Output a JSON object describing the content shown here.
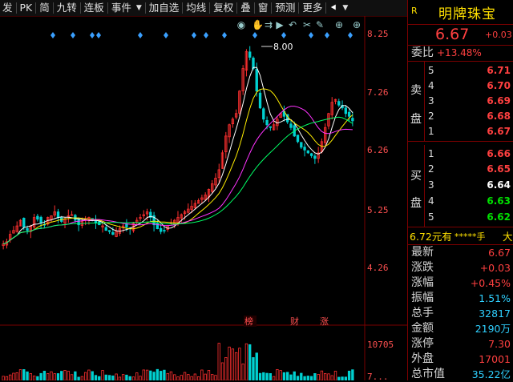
{
  "toolbar": {
    "items": [
      "发",
      "PK",
      "简",
      "九转",
      "连板",
      "事件",
      "▼",
      "加自选",
      "均线",
      "复权",
      "叠",
      "窗",
      "预测",
      "更多",
      "⯇",
      "▼"
    ]
  },
  "chart_icons": [
    "eye-icon",
    "hand-icon",
    "forward-icon",
    "play-icon",
    "undo-icon",
    "scissors-icon",
    "edit-icon",
    "plus-icon",
    "plus-icon"
  ],
  "price_axis": {
    "labels": [
      "8.25",
      "7.26",
      "6.26",
      "5.25",
      "4.26"
    ]
  },
  "volume_axis": {
    "labels": [
      "10705",
      "7..."
    ]
  },
  "annotations": {
    "high_label": "8.00",
    "events": [
      "榜",
      "财",
      "涨"
    ]
  },
  "colors": {
    "up": "#ff3030",
    "down": "#00d0d0",
    "ma5": "#ffffff",
    "ma10": "#ffee00",
    "ma20": "#ff33ff",
    "ma60": "#00ff66",
    "diamond": "#3aa0ff"
  },
  "chart_data": {
    "type": "candlestick",
    "ylim": [
      4.26,
      8.25
    ],
    "y_ticks": [
      8.25,
      7.26,
      6.26,
      5.25,
      4.26
    ],
    "high_label": 8.0,
    "closes": [
      4.48,
      4.52,
      4.65,
      4.72,
      4.8,
      4.9,
      4.78,
      4.72,
      4.8,
      4.95,
      4.92,
      4.85,
      4.82,
      4.95,
      4.98,
      5.05,
      4.95,
      4.88,
      4.92,
      4.98,
      5.0,
      4.9,
      4.82,
      4.88,
      4.92,
      4.95,
      4.9,
      4.85,
      4.82,
      4.8,
      4.72,
      4.7,
      4.65,
      4.7,
      4.75,
      4.8,
      4.78,
      4.75,
      4.85,
      4.9,
      4.95,
      5.0,
      5.05,
      4.95,
      4.82,
      4.75,
      4.7,
      4.72,
      4.8,
      4.85,
      4.9,
      4.95,
      5.0,
      5.05,
      5.1,
      5.15,
      5.2,
      5.25,
      5.3,
      5.35,
      5.45,
      5.55,
      5.65,
      5.8,
      6.1,
      6.4,
      6.6,
      6.7,
      6.8,
      7.2,
      7.6,
      7.9,
      7.8,
      7.6,
      7.2,
      6.9,
      6.7,
      6.6,
      6.55,
      6.6,
      6.7,
      6.8,
      6.75,
      6.65,
      6.55,
      6.4,
      6.3,
      6.2,
      6.15,
      6.1,
      6.05,
      6.0,
      6.1,
      6.3,
      6.55,
      6.8,
      7.0,
      7.05,
      6.95,
      6.9,
      6.8,
      6.75,
      6.67
    ],
    "ma_lines": [
      "MA5",
      "MA10",
      "MA20",
      "MA60"
    ]
  },
  "right_panel": {
    "code_label": "R",
    "name": "明牌珠宝",
    "price": "6.67",
    "change": "+0.03",
    "weibi_label": "委比",
    "weibi_value": "+13.48%",
    "sell_label": [
      "卖",
      "盘"
    ],
    "buy_label": [
      "买",
      "盘"
    ],
    "asks": [
      {
        "n": "5",
        "p": "6.71"
      },
      {
        "n": "4",
        "p": "6.70"
      },
      {
        "n": "3",
        "p": "6.69"
      },
      {
        "n": "2",
        "p": "6.68"
      },
      {
        "n": "1",
        "p": "6.67"
      }
    ],
    "bids": [
      {
        "n": "1",
        "p": "6.66"
      },
      {
        "n": "2",
        "p": "6.65"
      },
      {
        "n": "3",
        "p": "6.64"
      },
      {
        "n": "4",
        "p": "6.63"
      },
      {
        "n": "5",
        "p": "6.62"
      }
    ],
    "order_line": {
      "price": "6.72元有",
      "stars": "*****手",
      "tail": "大"
    },
    "stats": [
      {
        "label": "最新",
        "value": "6.67",
        "color": "red"
      },
      {
        "label": "涨跌",
        "value": "+0.03",
        "color": "red"
      },
      {
        "label": "涨幅",
        "value": "+0.45%",
        "color": "red"
      },
      {
        "label": "振幅",
        "value": "1.51%",
        "color": "cyan"
      },
      {
        "label": "总手",
        "value": "32817",
        "color": "cyan"
      },
      {
        "label": "金额",
        "value": "2190万",
        "color": "cyan"
      },
      {
        "label": "涨停",
        "value": "7.30",
        "color": "red"
      },
      {
        "label": "外盘",
        "value": "17001",
        "color": "red"
      },
      {
        "label": "总市值",
        "value": "35.22亿",
        "color": "cyan"
      }
    ]
  }
}
